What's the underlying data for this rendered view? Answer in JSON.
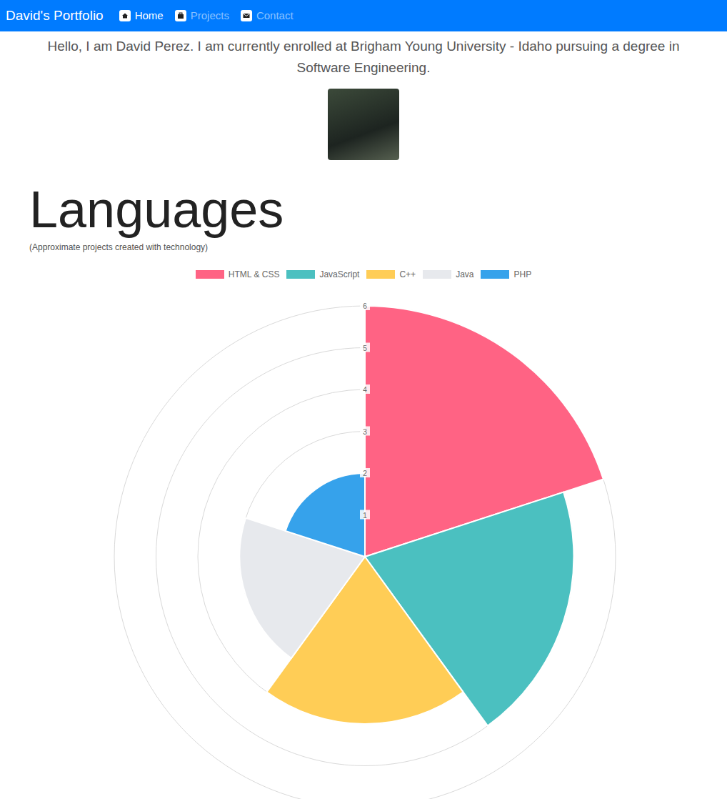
{
  "navbar": {
    "brand": "David's Portfolio",
    "items": [
      {
        "label": "Home",
        "selected": true
      },
      {
        "label": "Projects",
        "selected": false
      },
      {
        "label": "Contact",
        "selected": false
      }
    ]
  },
  "intro": "Hello, I am David Perez. I am currently enrolled at Brigham Young University - Idaho pursuing a degree in Software Engineering.",
  "languages": {
    "title": "Languages",
    "subtitle": "(Approximate projects created with technology)",
    "chart": {
      "ticks": [
        "1",
        "2",
        "3",
        "4",
        "5",
        "6"
      ],
      "series": [
        {
          "label": "HTML & CSS",
          "value": 6,
          "color": "#ff6384"
        },
        {
          "label": "JavaScript",
          "value": 5,
          "color": "#4bc0c0"
        },
        {
          "label": "C++",
          "value": 4,
          "color": "#ffcd56"
        },
        {
          "label": "Java",
          "value": 3,
          "color": "#e7e9ed"
        },
        {
          "label": "PHP",
          "value": 2,
          "color": "#36a2eb"
        }
      ]
    }
  }
}
